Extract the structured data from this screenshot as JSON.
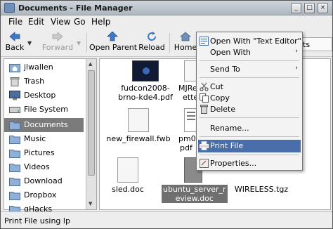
{
  "window": {
    "title": "Documents - File Manager",
    "controls": [
      "_",
      "□",
      "×"
    ]
  },
  "menubar": {
    "items": [
      {
        "label": "File"
      },
      {
        "label": "Edit"
      },
      {
        "label": "View"
      },
      {
        "label": "Go"
      },
      {
        "label": "Help"
      }
    ]
  },
  "toolbar": {
    "back_label": "Back",
    "forward_label": "Forward",
    "open_parent_label": "Open Parent",
    "reload_label": "Reload",
    "home_label": "Home",
    "overflow_label": "ts"
  },
  "sidebar": {
    "items": [
      {
        "label": "jlwallen",
        "icon": "home-folder-icon"
      },
      {
        "label": "Trash",
        "icon": "trash-icon"
      },
      {
        "label": "Desktop",
        "icon": "desktop-icon"
      },
      {
        "label": "File System",
        "icon": "drive-icon"
      },
      {
        "label": "Documents",
        "icon": "folder-icon"
      },
      {
        "label": "Music",
        "icon": "folder-icon"
      },
      {
        "label": "Pictures",
        "icon": "folder-icon"
      },
      {
        "label": "Videos",
        "icon": "folder-icon"
      },
      {
        "label": "Download",
        "icon": "folder-icon"
      },
      {
        "label": "Dropbox",
        "icon": "folder-icon"
      },
      {
        "label": "gHacks",
        "icon": "folder-icon"
      }
    ],
    "selected": "Documents"
  },
  "files": [
    {
      "name_line1": "fudcon2008-",
      "name_line2": "brno-kde4.pdf"
    },
    {
      "name_line1": "MJRequir",
      "name_line2": "etter.doc"
    },
    {
      "name_line1": "new_firewall.fwb",
      "name_line2": ""
    },
    {
      "name_line1": "pm04018",
      "name_line2": "pdf"
    },
    {
      "name_line1": "sled.doc",
      "name_line2": ""
    },
    {
      "name_line1": "ubuntu_server_r",
      "name_line2": "eview.doc"
    },
    {
      "name_line1": "WIRELESS.tgz",
      "name_line2": ""
    }
  ],
  "context_menu": {
    "items": [
      {
        "label": "Open With \"Text Editor\"",
        "icon": "text-editor-icon",
        "submenu": false
      },
      {
        "label": "Open With",
        "icon": "",
        "submenu": true
      },
      {
        "label": "Send To",
        "icon": "",
        "submenu": true
      },
      {
        "label": "Cut",
        "icon": "scissors-icon",
        "submenu": false
      },
      {
        "label": "Copy",
        "icon": "copy-icon",
        "submenu": false
      },
      {
        "label": "Delete",
        "icon": "delete-icon",
        "submenu": false
      },
      {
        "label": "Rename...",
        "icon": "",
        "submenu": false
      },
      {
        "label": "Print File",
        "icon": "printer-icon",
        "submenu": false
      },
      {
        "label": "Properties...",
        "icon": "properties-icon",
        "submenu": false
      }
    ],
    "highlighted": "Print File",
    "submenu_arrow": "›"
  },
  "status": {
    "text": "Print File using lp"
  },
  "colors": {
    "selection": "#7b7b7b",
    "menu_highlight": "#4a6ea9"
  }
}
